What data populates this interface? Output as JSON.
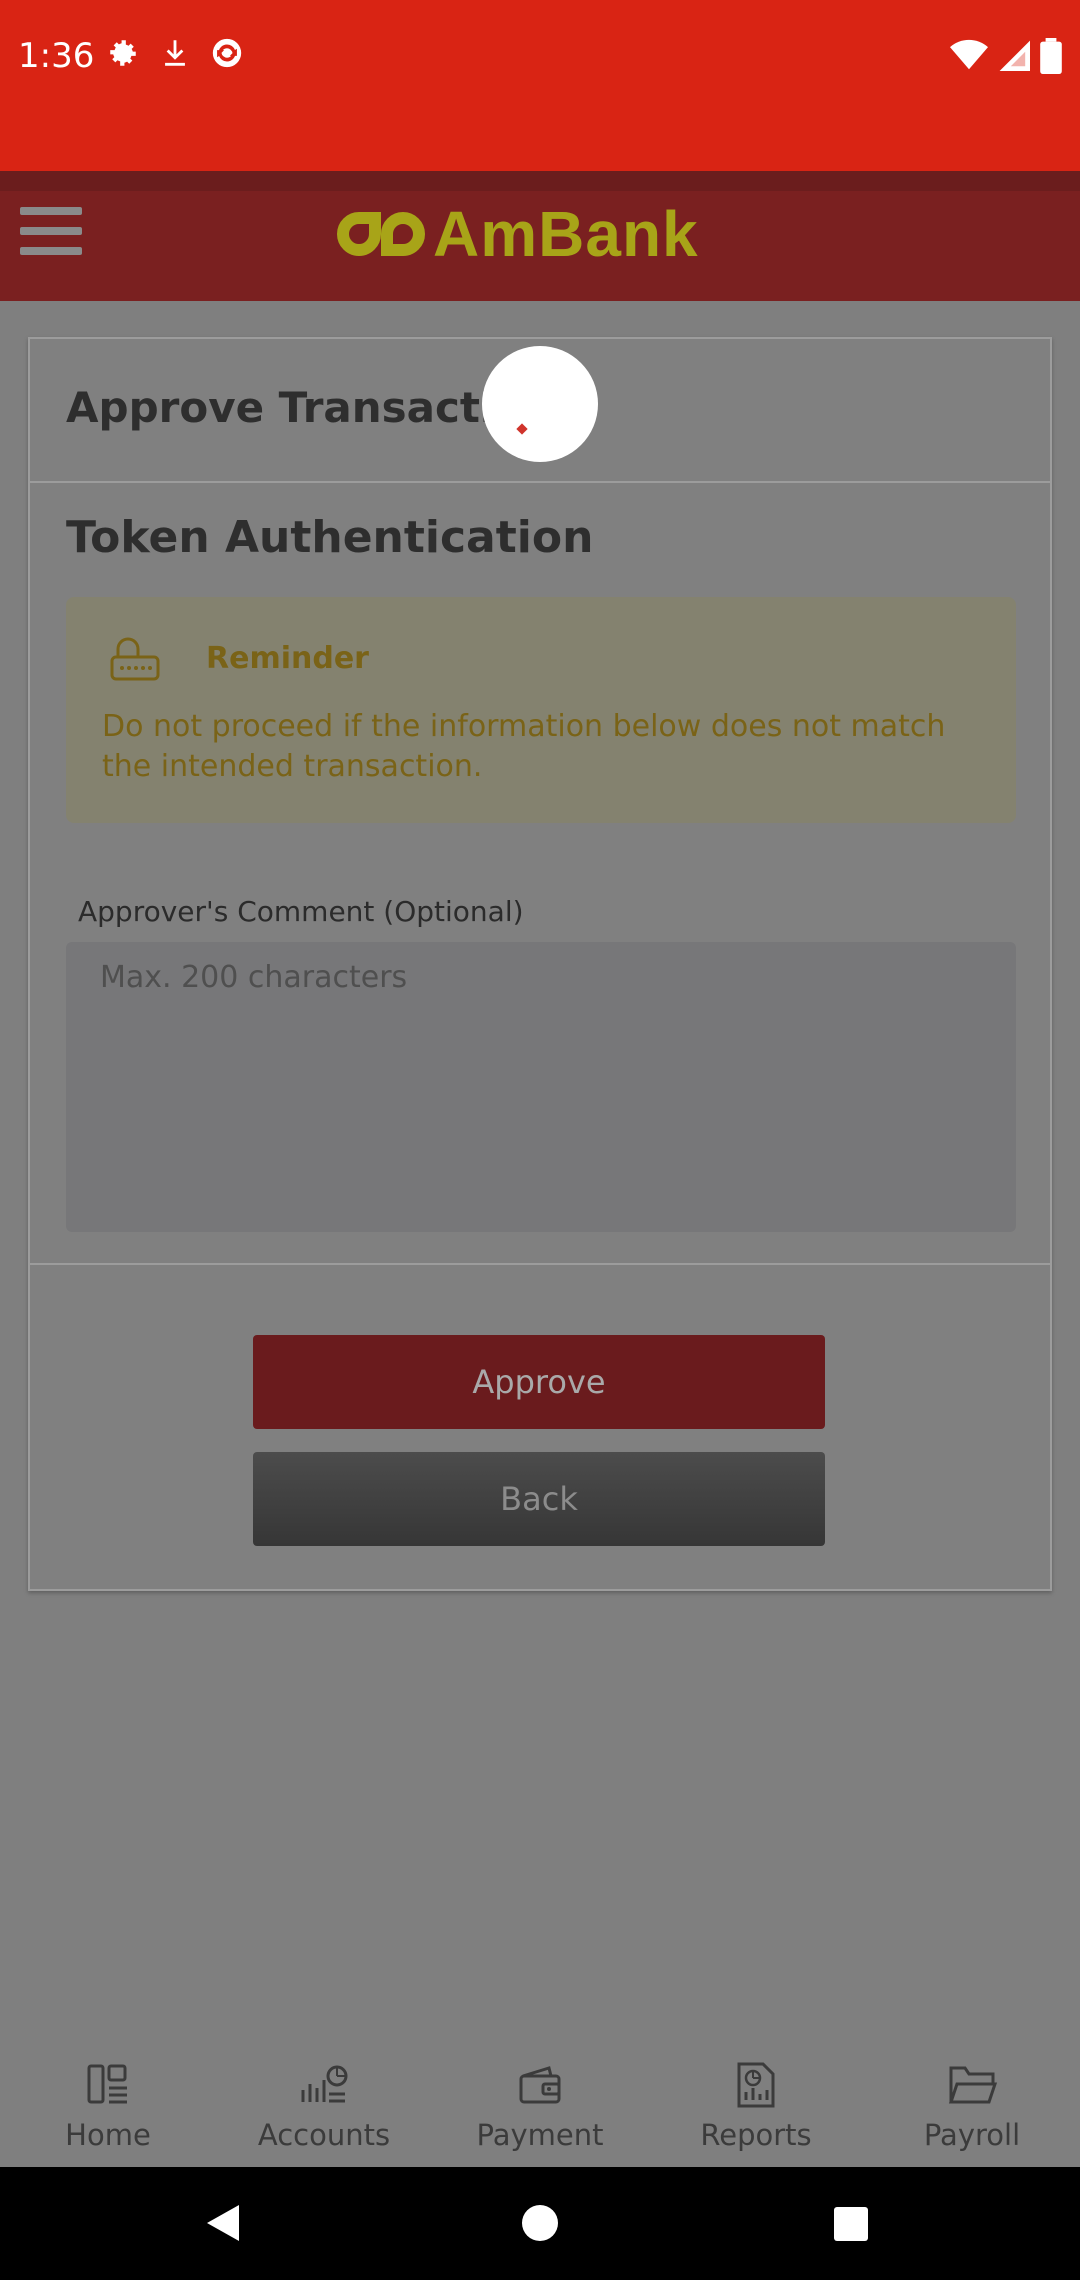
{
  "status_bar": {
    "time": "1:36",
    "left_icons": [
      "gear-icon",
      "download-icon",
      "sync-icon"
    ],
    "right_icons": [
      "wifi-icon",
      "cell-signal-icon",
      "battery-icon"
    ]
  },
  "header": {
    "brand": "AmBank",
    "colors": {
      "bar": "#7a2020",
      "logo": "#a8a418"
    }
  },
  "page": {
    "title": "Approve Transaction",
    "section_title": "Token Authentication",
    "reminder": {
      "title": "Reminder",
      "text": "Do not proceed if the information below does not match the intended transaction."
    },
    "comment": {
      "label": "Approver's Comment (Optional)",
      "placeholder": "Max. 200 characters",
      "value": ""
    },
    "buttons": {
      "approve": "Approve",
      "back": "Back"
    }
  },
  "bottom_nav": {
    "items": [
      {
        "label": "Home",
        "icon": "home-icon"
      },
      {
        "label": "Accounts",
        "icon": "accounts-icon"
      },
      {
        "label": "Payment",
        "icon": "wallet-icon"
      },
      {
        "label": "Reports",
        "icon": "reports-icon"
      },
      {
        "label": "Payroll",
        "icon": "folder-icon"
      }
    ]
  }
}
